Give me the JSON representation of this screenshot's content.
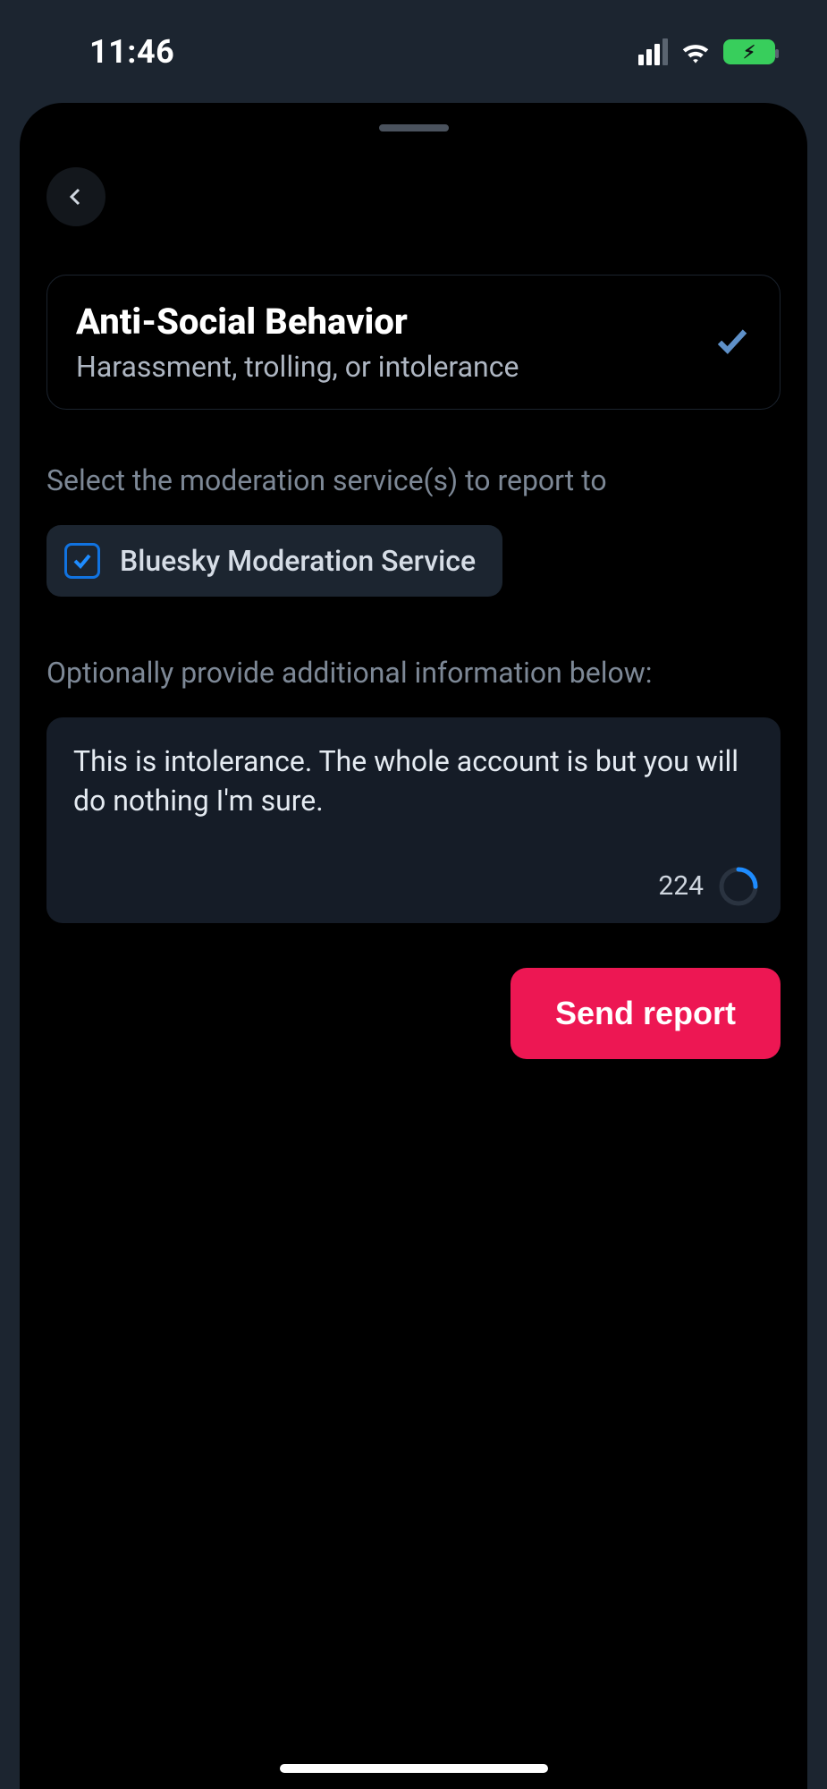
{
  "status": {
    "time": "11:46"
  },
  "report": {
    "reason_title": "Anti-Social Behavior",
    "reason_subtitle": "Harassment, trolling, or intolerance",
    "services_label": "Select the moderation service(s) to report to",
    "service_name": "Bluesky Moderation Service",
    "additional_label": "Optionally provide additional information below:",
    "textarea_value": "This is intolerance. The whole account is but you will do nothing I'm sure.",
    "char_remaining": "224",
    "send_label": "Send report"
  }
}
